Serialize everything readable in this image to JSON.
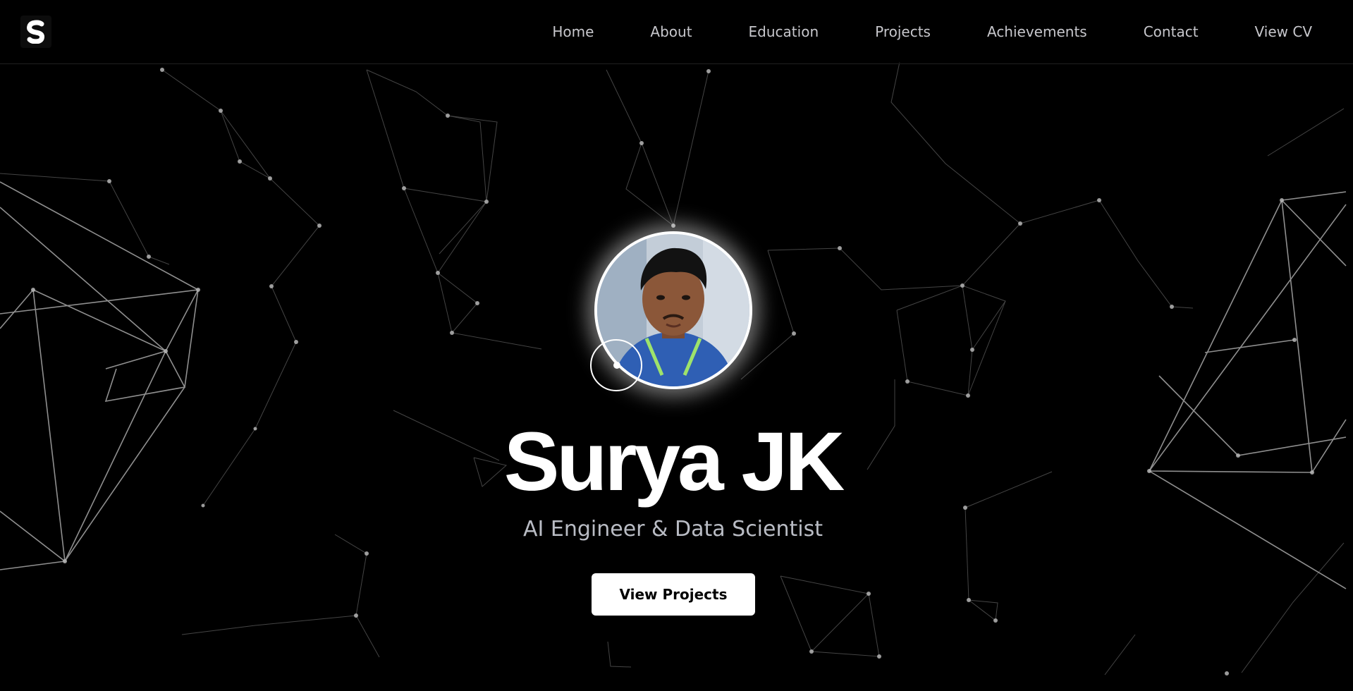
{
  "brand": {
    "logo_letter": "S",
    "logo_icon": "s-logo-icon"
  },
  "nav": {
    "items": [
      {
        "label": "Home"
      },
      {
        "label": "About"
      },
      {
        "label": "Education"
      },
      {
        "label": "Projects"
      },
      {
        "label": "Achievements"
      },
      {
        "label": "Contact"
      },
      {
        "label": "View CV"
      }
    ]
  },
  "hero": {
    "name": "Surya JK",
    "subtitle": "AI Engineer & Data Scientist",
    "cta_label": "View Projects"
  },
  "colors": {
    "background": "#000000",
    "text": "#ffffff",
    "nav_text": "#c7c7cc",
    "subtitle_text": "#b9bcc4",
    "network_line": "#8a8a8a"
  }
}
